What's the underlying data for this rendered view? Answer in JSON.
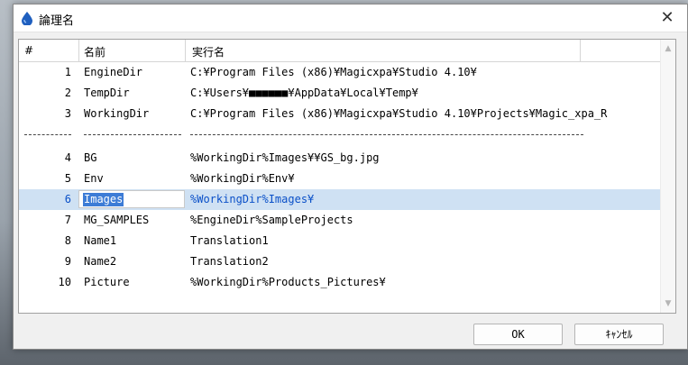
{
  "window": {
    "title": "論理名",
    "close_glyph": "✕"
  },
  "columns": {
    "num": "#",
    "name": "名前",
    "value": "実行名"
  },
  "rows_top": [
    {
      "num": "1",
      "name": "EngineDir",
      "value": "C:¥Program Files (x86)¥Magicxpa¥Studio 4.10¥"
    },
    {
      "num": "2",
      "name": "TempDir",
      "value": "C:¥Users¥■■■■■■¥AppData¥Local¥Temp¥"
    },
    {
      "num": "3",
      "name": "WorkingDir",
      "value": "C:¥Program Files (x86)¥Magicxpa¥Studio 4.10¥Projects¥Magic_xpa_R"
    }
  ],
  "divider": {
    "num": "--------",
    "name": "-----------------",
    "value": "------------------------------------------------------------------------"
  },
  "rows_bottom": [
    {
      "num": "4",
      "name": "BG",
      "value": "%WorkingDir%Images¥¥GS_bg.jpg"
    },
    {
      "num": "5",
      "name": "Env",
      "value": "%WorkingDir%Env¥"
    },
    {
      "num": "6",
      "name": "Images",
      "value": "%WorkingDir%Images¥",
      "selected": true
    },
    {
      "num": "7",
      "name": "MG_SAMPLES",
      "value": "%EngineDir%SampleProjects"
    },
    {
      "num": "8",
      "name": "Name1",
      "value": "Translation1"
    },
    {
      "num": "9",
      "name": "Name2",
      "value": "Translation2"
    },
    {
      "num": "10",
      "name": "Picture",
      "value": "%WorkingDir%Products_Pictures¥"
    }
  ],
  "buttons": {
    "ok": "OK",
    "cancel": "ｷｬﾝｾﾙ"
  },
  "colors": {
    "selection": "#cfe1f3",
    "selected_text": "#0a50c8",
    "edit_highlight": "#3d7cd6"
  },
  "icons": {
    "app": "drop-icon",
    "close": "close-icon",
    "scroll_up": "scroll-up-arrow-icon",
    "scroll_down": "scroll-down-arrow-icon"
  }
}
